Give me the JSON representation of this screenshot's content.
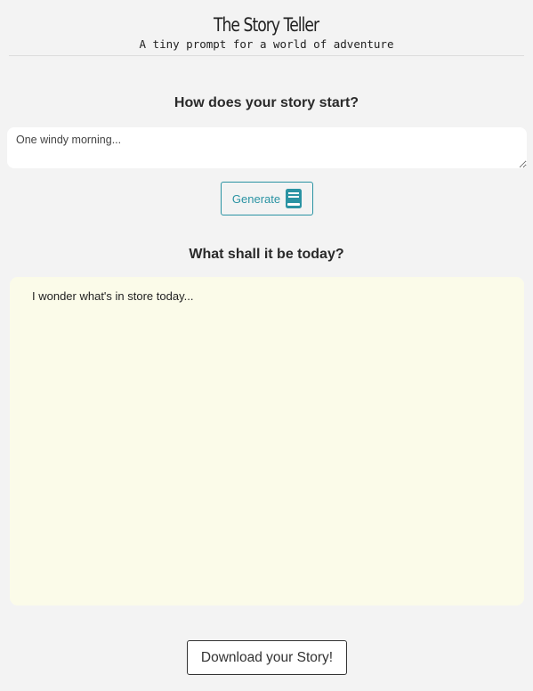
{
  "header": {
    "title": "The Story Teller",
    "subtitle": "A tiny prompt for a world of adventure"
  },
  "prompt_section": {
    "heading": "How does your story start?",
    "input_placeholder": "One windy morning...",
    "input_value": "",
    "generate_label": "Generate",
    "generate_icon": "book-icon"
  },
  "story_section": {
    "heading": "What shall it be today?",
    "story_text": "I wonder what's in store today..."
  },
  "download": {
    "label": "Download your Story!"
  },
  "colors": {
    "accent": "#2a93a3",
    "background": "#f3f3f3",
    "story_background": "#fbfbe9"
  }
}
